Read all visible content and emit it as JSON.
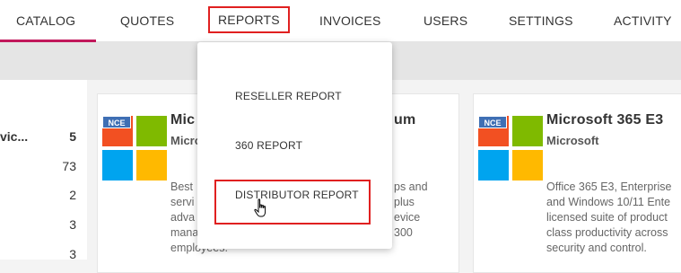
{
  "nav": {
    "tabs": [
      {
        "label": "CATALOG"
      },
      {
        "label": "QUOTES"
      },
      {
        "label": "REPORTS"
      },
      {
        "label": "INVOICES"
      },
      {
        "label": "USERS"
      },
      {
        "label": "SETTINGS"
      },
      {
        "label": "ACTIVITY"
      }
    ],
    "active_tab": "CATALOG",
    "accent_color": "#c2185b"
  },
  "reports_menu": {
    "items": [
      {
        "label": "RESELLER REPORT"
      },
      {
        "label": "360 REPORT"
      },
      {
        "label": "DISTRIBUTOR REPORT"
      }
    ]
  },
  "filter_list": {
    "rows": [
      {
        "label": "vic...",
        "count": "5"
      },
      {
        "label": "",
        "count": "73"
      },
      {
        "label": "",
        "count": "2"
      },
      {
        "label": "",
        "count": "3"
      },
      {
        "label": "",
        "count": "3"
      }
    ]
  },
  "cards": [
    {
      "badge": "NCE",
      "title_left": "Mic",
      "title_right": "um",
      "vendor": "Micro",
      "desc_left": [
        "Best",
        "servi",
        "adva",
        "mana",
        "employees."
      ],
      "desc_right": [
        "ps and",
        "plus",
        "evice",
        "300",
        ""
      ]
    },
    {
      "badge": "NCE",
      "title": "Microsoft 365 E3",
      "vendor": "Microsoft",
      "desc": [
        "Office 365 E3, Enterprise",
        "and Windows 10/11 Ente",
        "licensed suite of product",
        "class productivity across",
        "security and control."
      ]
    }
  ],
  "colors": {
    "ms_red": "#f25022",
    "ms_green": "#7fba00",
    "ms_blue": "#00a4ef",
    "ms_yellow": "#ffb900",
    "highlight": "#e02020"
  }
}
